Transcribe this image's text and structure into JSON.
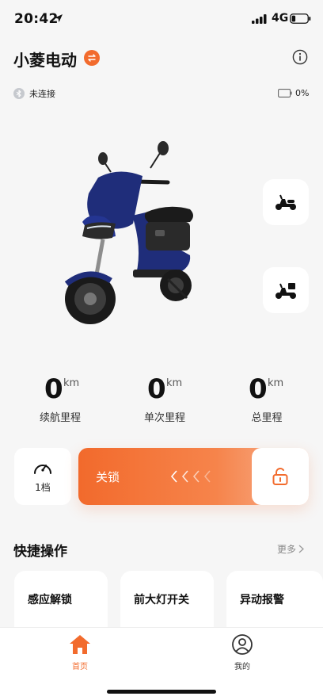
{
  "status_bar": {
    "time": "20:42",
    "network": "4G"
  },
  "header": {
    "title": "小菱电动"
  },
  "connection": {
    "status": "未连接",
    "battery_percent": "0%"
  },
  "stats": [
    {
      "value": "0",
      "unit": "km",
      "label": "续航里程"
    },
    {
      "value": "0",
      "unit": "km",
      "label": "单次里程"
    },
    {
      "value": "0",
      "unit": "km",
      "label": "总里程"
    }
  ],
  "gear": {
    "label": "1档"
  },
  "lock": {
    "label": "关锁"
  },
  "quick_ops": {
    "title": "快捷操作",
    "more_label": "更多",
    "items": [
      {
        "label": "感应解锁"
      },
      {
        "label": "前大灯开关"
      },
      {
        "label": "异动报警"
      }
    ]
  },
  "bottom_nav": {
    "items": [
      {
        "label": "首页",
        "active": true
      },
      {
        "label": "我的",
        "active": false
      }
    ]
  },
  "colors": {
    "accent": "#f26b2d",
    "background": "#f6f6f6",
    "scooter_body": "#1f2d7a"
  }
}
